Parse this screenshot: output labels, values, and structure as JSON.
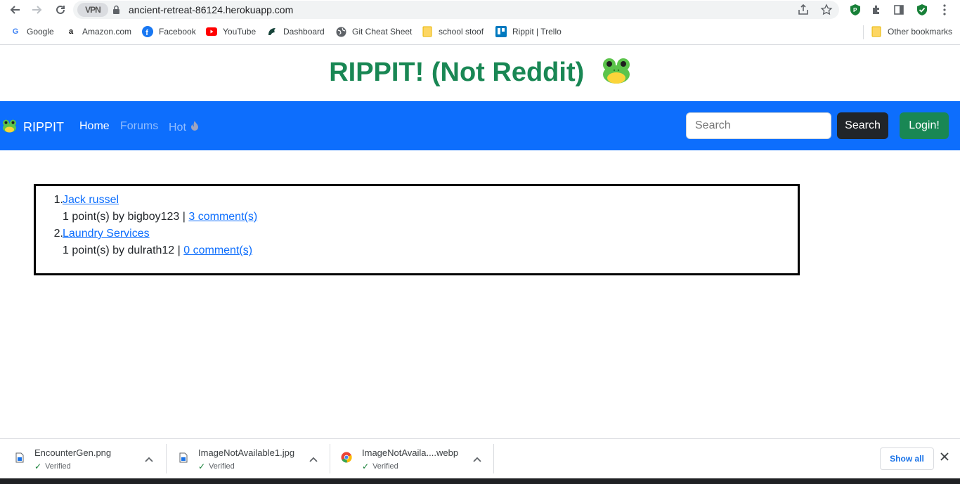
{
  "browser": {
    "url": "ancient-retreat-86124.herokuapp.com",
    "vpn_label": "VPN"
  },
  "bookmarks": {
    "items": [
      {
        "label": "Google"
      },
      {
        "label": "Amazon.com"
      },
      {
        "label": "Facebook"
      },
      {
        "label": "YouTube"
      },
      {
        "label": "Dashboard"
      },
      {
        "label": "Git Cheat Sheet"
      },
      {
        "label": "school stoof"
      },
      {
        "label": "Rippit | Trello"
      }
    ],
    "other": "Other bookmarks"
  },
  "page": {
    "title": "RIPPIT! (Not Reddit)"
  },
  "navbar": {
    "brand": "RIPPIT",
    "links": [
      {
        "label": "Home",
        "active": true
      },
      {
        "label": "Forums",
        "active": false
      },
      {
        "label": "Hot",
        "active": false
      }
    ],
    "search_placeholder": "Search",
    "search_button": "Search",
    "login_button": "Login!"
  },
  "posts": [
    {
      "number": "1.",
      "title": "Jack russel",
      "meta": "1 point(s) by bigboy123 | ",
      "comments": "3 comment(s)"
    },
    {
      "number": "2.",
      "title": "Laundry Services",
      "meta": "1 point(s) by dulrath12 | ",
      "comments": "0 comment(s)"
    }
  ],
  "downloads": {
    "items": [
      {
        "filename": "EncounterGen.png",
        "status": "Verified"
      },
      {
        "filename": "ImageNotAvailable1.jpg",
        "status": "Verified"
      },
      {
        "filename": "ImageNotAvaila....webp",
        "status": "Verified"
      }
    ],
    "show_all": "Show all"
  },
  "colors": {
    "brand_green": "#198754",
    "navbar_blue": "#0d6efd",
    "link_blue": "#0d6efd"
  }
}
